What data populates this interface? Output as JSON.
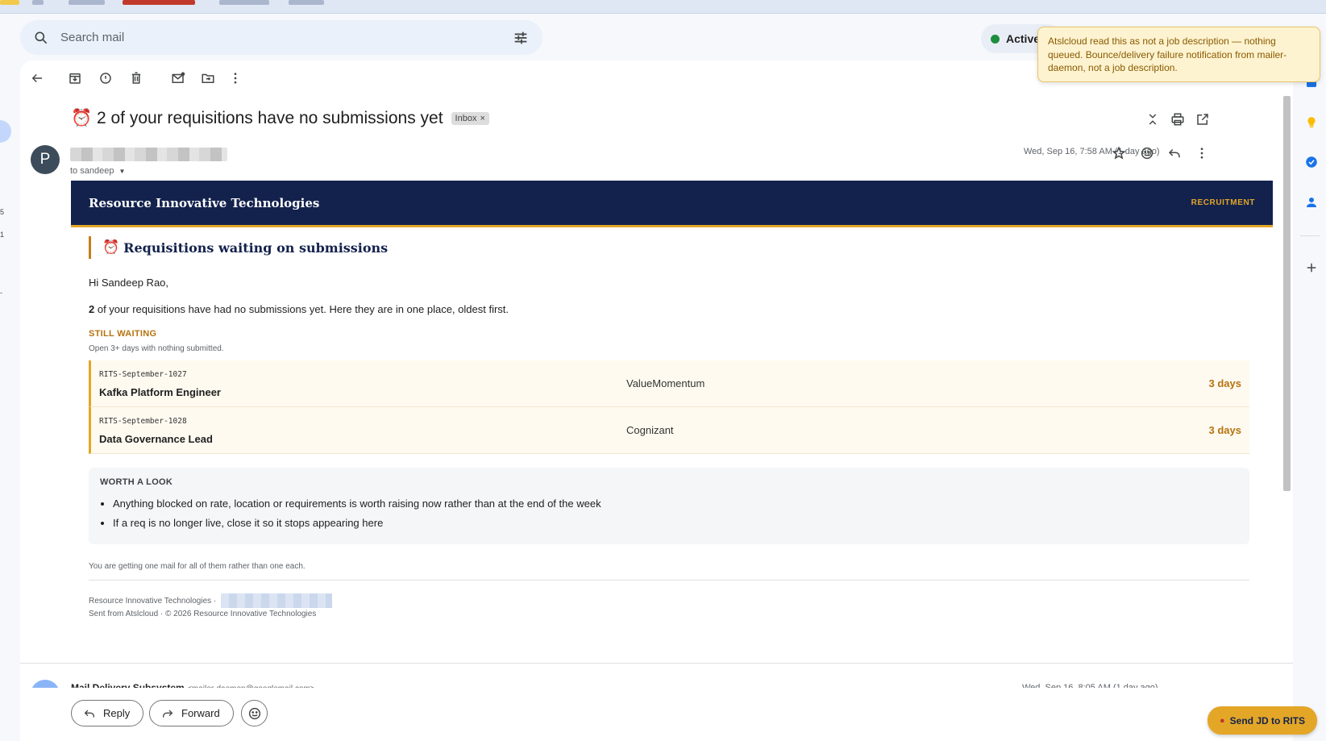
{
  "search": {
    "placeholder": "Search mail"
  },
  "status": {
    "label": "Active"
  },
  "toast": {
    "message": "Atslcloud read this as not a job description — nothing queued. Bounce/delivery failure notification from mailer-daemon, not a job description."
  },
  "email": {
    "subject": "⏰ 2 of your requisitions have no submissions yet",
    "label_chip": "Inbox",
    "sender_initial": "P",
    "to_line": "to sandeep",
    "date": "Wed, Sep 16, 7:58 AM (1 day ago)"
  },
  "body": {
    "brand": "Resource Innovative Technologies",
    "banner_tag": "RECRUITMENT",
    "section_icon": "⏰",
    "section_title": "Requisitions waiting on submissions",
    "greeting": "Hi Sandeep Rao,",
    "summary_count": "2",
    "summary_text": " of your requisitions have had no submissions yet. Here they are in one place, oldest first.",
    "still_waiting_title": "STILL WAITING",
    "still_waiting_sub": "Open 3+ days with nothing submitted.",
    "requisitions": [
      {
        "code": "RITS-September-1027",
        "role": "Kafka Platform Engineer",
        "client": "ValueMomentum",
        "age": "3 days"
      },
      {
        "code": "RITS-September-1028",
        "role": "Data Governance Lead",
        "client": "Cognizant",
        "age": "3 days"
      }
    ],
    "worth_title": "WORTH A LOOK",
    "worth_items": [
      "Anything blocked on rate, location or requirements is worth raising now rather than at the end of the week",
      "If a req is no longer live, close it so it stops appearing here"
    ],
    "note": "You are getting one mail for all of them rather than one each.",
    "footer_company": "Resource Innovative Technologies ·",
    "footer_sent": "Sent from Atslcloud · © 2026 Resource Innovative Technologies"
  },
  "next_message": {
    "sender": "Mail Delivery Subsystem",
    "address": "<mailer-daemon@googlemail.com>",
    "date": "Wed, Sep 16, 8:05 AM (1 day ago)"
  },
  "reply_bar": {
    "reply_label": "Reply",
    "forward_label": "Forward"
  },
  "extension": {
    "send_jd_label": "Send JD to RITS"
  },
  "colors": {
    "navy": "#13224d",
    "gold": "#e3a627",
    "amber_text": "#b5730f",
    "active_green": "#1e8e3e"
  }
}
